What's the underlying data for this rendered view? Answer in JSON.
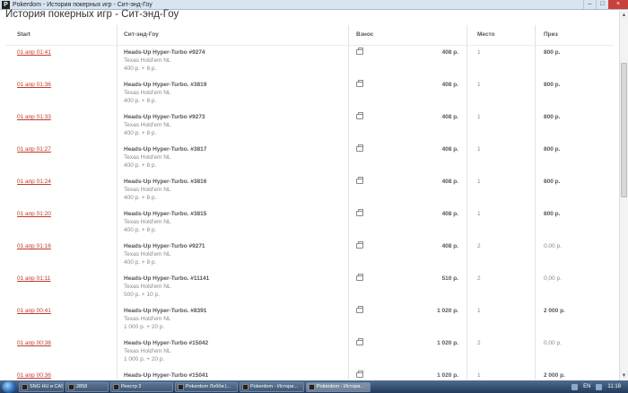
{
  "window": {
    "app_icon": "P",
    "title": "Pokerdom - История покерных игр - Сит-энд-Гоу",
    "controls": [
      "–",
      "□",
      "×"
    ]
  },
  "page": {
    "title": "История покерных игр - Сит-энд-Гоу"
  },
  "table": {
    "headers": {
      "start": "Start",
      "sng": "Сит-энд-Гоу",
      "fee": "Взнос",
      "place": "Место",
      "prize": "Приз"
    },
    "rows": [
      {
        "date": "01 апр 01:41",
        "name": "Heads-Up Hyper-Turbo #9274",
        "game": "Texas Hold'em NL",
        "buyin": "400 р. + 8 р.",
        "fee": "408 р.",
        "place": "1",
        "prize": "800 р."
      },
      {
        "date": "01 апр 01:36",
        "name": "Heads-Up Hyper-Turbo. #3819",
        "game": "Texas Hold'em NL",
        "buyin": "400 р. + 8 р.",
        "fee": "408 р.",
        "place": "1",
        "prize": "800 р."
      },
      {
        "date": "01 апр 01:33",
        "name": "Heads-Up Hyper-Turbo #9273",
        "game": "Texas Hold'em NL",
        "buyin": "400 р. + 8 р.",
        "fee": "408 р.",
        "place": "1",
        "prize": "800 р."
      },
      {
        "date": "01 апр 01:27",
        "name": "Heads-Up Hyper-Turbo. #3817",
        "game": "Texas Hold'em NL",
        "buyin": "400 р. + 8 р.",
        "fee": "408 р.",
        "place": "1",
        "prize": "800 р."
      },
      {
        "date": "01 апр 01:24",
        "name": "Heads-Up Hyper-Turbo. #3816",
        "game": "Texas Hold'em NL",
        "buyin": "400 р. + 8 р.",
        "fee": "408 р.",
        "place": "1",
        "prize": "800 р."
      },
      {
        "date": "01 апр 01:20",
        "name": "Heads-Up Hyper-Turbo. #3815",
        "game": "Texas Hold'em NL",
        "buyin": "400 р. + 8 р.",
        "fee": "408 р.",
        "place": "1",
        "prize": "800 р."
      },
      {
        "date": "01 апр 01:16",
        "name": "Heads-Up Hyper-Turbo #9271",
        "game": "Texas Hold'em NL",
        "buyin": "400 р. + 8 р.",
        "fee": "408 р.",
        "place": "2",
        "prize": "0,00 р."
      },
      {
        "date": "01 апр 01:11",
        "name": "Heads-Up Hyper-Turbo. #11141",
        "game": "Texas Hold'em NL",
        "buyin": "500 р. + 10 р.",
        "fee": "510 р.",
        "place": "2",
        "prize": "0,00 р."
      },
      {
        "date": "01 апр 00:41",
        "name": "Heads-Up Hyper-Turbo. #8391",
        "game": "Texas Hold'em NL",
        "buyin": "1 000 р. + 20 р.",
        "fee": "1 020 р.",
        "place": "1",
        "prize": "2 000 р."
      },
      {
        "date": "01 апр 00:38",
        "name": "Heads-Up Hyper-Turbo #15042",
        "game": "Texas Hold'em NL",
        "buyin": "1 000 р. + 20 р.",
        "fee": "1 020 р.",
        "place": "2",
        "prize": "0,00 р."
      },
      {
        "date": "01 апр 00:36",
        "name": "Heads-Up Hyper-Turbo #15041",
        "game": "Texas Hold'em NL",
        "buyin": "1 000 р. + 20 р.",
        "fee": "1 020 р.",
        "place": "1",
        "prize": "2 000 р."
      }
    ]
  },
  "scrollbar": {
    "up_arrow": "▲",
    "down_arrow": "▼"
  },
  "taskbar": {
    "items": [
      {
        "label": "SNG HU и CASH HU ...",
        "icon": "browser-icon",
        "active": false
      },
      {
        "label": "2858",
        "icon": "folder-icon",
        "active": false
      },
      {
        "label": "Реестр 2",
        "icon": "spreadsheet-icon",
        "active": false
      },
      {
        "label": "Pokerdom Лобби |...",
        "icon": "pokerdom-icon",
        "active": false
      },
      {
        "label": "Pokerdom - Истори...",
        "icon": "pokerdom-icon",
        "active": false
      },
      {
        "label": "Pokerdom - Истори...",
        "icon": "pokerdom-icon",
        "active": true
      }
    ],
    "lang": "EN",
    "clock": "11:18"
  },
  "colors": {
    "link": "#c0392b",
    "header_text": "#555555",
    "muted_text": "#888888",
    "titlebar": "#d9e4f1",
    "close_button": "#c9413a"
  }
}
